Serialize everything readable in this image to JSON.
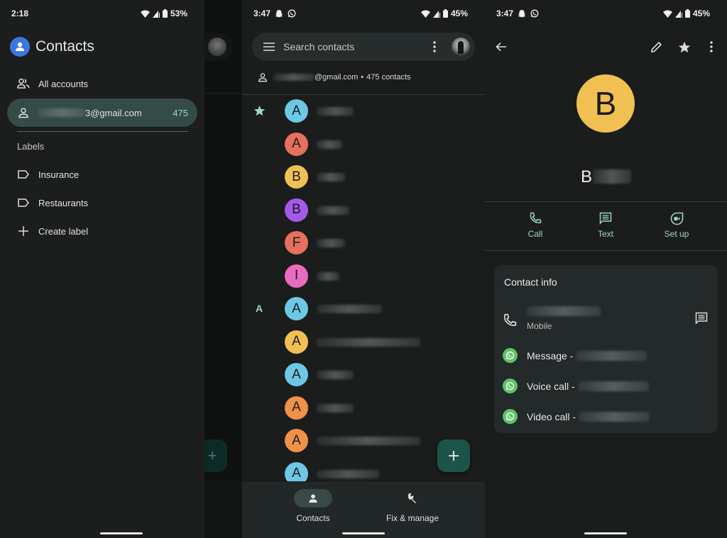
{
  "panel1": {
    "status": {
      "time": "2:18",
      "battery": "53%"
    },
    "app_title": "Contacts",
    "all_accounts_label": "All accounts",
    "account": {
      "email_visible": "3@gmail.com",
      "count": "475"
    },
    "labels_heading": "Labels",
    "labels": [
      {
        "label": "Insurance",
        "icon": "label-icon"
      },
      {
        "label": "Restaurants",
        "icon": "label-icon"
      }
    ],
    "create_label": "Create label",
    "fab_icon": "plus-icon"
  },
  "panel2": {
    "status": {
      "time": "3:47",
      "battery": "45%",
      "notif_icons": [
        "snapchat-icon",
        "whatsapp-icon"
      ]
    },
    "search": {
      "placeholder": "Search contacts"
    },
    "account_row": {
      "email_visible": "@gmail.com",
      "separator": "•",
      "count_text": "475 contacts"
    },
    "contacts": [
      {
        "section": "star",
        "initial": "A",
        "color": "#6ec8e4"
      },
      {
        "section": "",
        "initial": "A",
        "color": "#e5705e"
      },
      {
        "section": "",
        "initial": "B",
        "color": "#f1c052"
      },
      {
        "section": "",
        "initial": "B",
        "color": "#a35ae8"
      },
      {
        "section": "",
        "initial": "F",
        "color": "#e5705e"
      },
      {
        "section": "",
        "initial": "I",
        "color": "#e86bbf"
      },
      {
        "section": "A",
        "initial": "A",
        "color": "#6ec8e4"
      },
      {
        "section": "",
        "initial": "A",
        "color": "#f1c052"
      },
      {
        "section": "",
        "initial": "A",
        "color": "#6ec8e4"
      },
      {
        "section": "",
        "initial": "A",
        "color": "#ef9249"
      },
      {
        "section": "",
        "initial": "A",
        "color": "#ef9249"
      },
      {
        "section": "",
        "initial": "A",
        "color": "#6ec8e4"
      }
    ],
    "nav": [
      {
        "label": "Contacts",
        "icon": "person-icon",
        "active": true
      },
      {
        "label": "Fix & manage",
        "icon": "wrench-icon",
        "active": false
      }
    ]
  },
  "panel3": {
    "status": {
      "time": "3:47",
      "battery": "45%",
      "notif_icons": [
        "snapchat-icon",
        "whatsapp-icon"
      ]
    },
    "avatar_initial": "B",
    "avatar_color": "#f1c052",
    "name_visible": "B",
    "actions": [
      {
        "label": "Call",
        "icon": "phone-icon"
      },
      {
        "label": "Text",
        "icon": "message-icon"
      },
      {
        "label": "Set up",
        "icon": "video-icon"
      }
    ],
    "contact_info": {
      "title": "Contact info",
      "phone_type": "Mobile",
      "whatsapp": [
        {
          "label": "Message -"
        },
        {
          "label": "Voice call -"
        },
        {
          "label": "Video call -"
        }
      ]
    }
  },
  "colors": {
    "accent": "#9fd6c8",
    "active_pill": "#344b47",
    "fab": "#1d5449",
    "whatsapp": "#5dc46a",
    "logo": "#3b77e0"
  }
}
